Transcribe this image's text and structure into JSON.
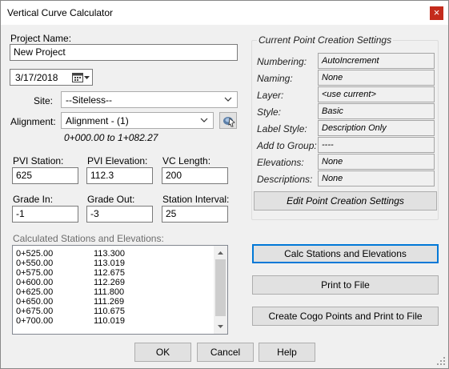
{
  "window": {
    "title": "Vertical Curve Calculator",
    "close_glyph": "×"
  },
  "project": {
    "label": "Project Name:",
    "value": "New Project"
  },
  "date": {
    "value": "3/17/2018"
  },
  "site": {
    "label": "Site:",
    "value": "--Siteless--"
  },
  "alignment": {
    "label": "Alignment:",
    "value": "Alignment - (1)",
    "range": "0+000.00 to 1+082.27"
  },
  "pvi_station": {
    "label": "PVI Station:",
    "value": "625"
  },
  "pvi_elevation": {
    "label": "PVI Elevation:",
    "value": "112.3"
  },
  "vc_length": {
    "label": "VC Length:",
    "value": "200"
  },
  "grade_in": {
    "label": "Grade In:",
    "value": "-1"
  },
  "grade_out": {
    "label": "Grade Out:",
    "value": "-3"
  },
  "station_interval": {
    "label": "Station Interval:",
    "value": "25"
  },
  "calc_list": {
    "label": "Calculated Stations and Elevations:",
    "rows": [
      {
        "station": "0+525.00",
        "elevation": "113.300"
      },
      {
        "station": "0+550.00",
        "elevation": "113.019"
      },
      {
        "station": "0+575.00",
        "elevation": "112.675"
      },
      {
        "station": "0+600.00",
        "elevation": "112.269"
      },
      {
        "station": "0+625.00",
        "elevation": "111.800"
      },
      {
        "station": "0+650.00",
        "elevation": "111.269"
      },
      {
        "station": "0+675.00",
        "elevation": "110.675"
      },
      {
        "station": "0+700.00",
        "elevation": "110.019"
      }
    ]
  },
  "point_settings": {
    "title": "Current Point Creation Settings",
    "rows": [
      {
        "label": "Numbering:",
        "value": "AutoIncrement"
      },
      {
        "label": "Naming:",
        "value": "None"
      },
      {
        "label": "Layer:",
        "value": "<use current>"
      },
      {
        "label": "Style:",
        "value": "Basic"
      },
      {
        "label": "Label Style:",
        "value": "Description Only"
      },
      {
        "label": "Add to Group:",
        "value": "----"
      },
      {
        "label": "Elevations:",
        "value": "None"
      },
      {
        "label": "Descriptions:",
        "value": "None"
      }
    ],
    "edit_button": "Edit Point Creation Settings"
  },
  "buttons": {
    "calc": "Calc Stations and Elevations",
    "print": "Print to File",
    "cogo": "Create Cogo Points and Print to File",
    "ok": "OK",
    "cancel": "Cancel",
    "help": "Help"
  },
  "colors": {
    "close": "#c42b1c",
    "focus": "#0078d7",
    "dialog_bg": "#f0f0f0"
  }
}
